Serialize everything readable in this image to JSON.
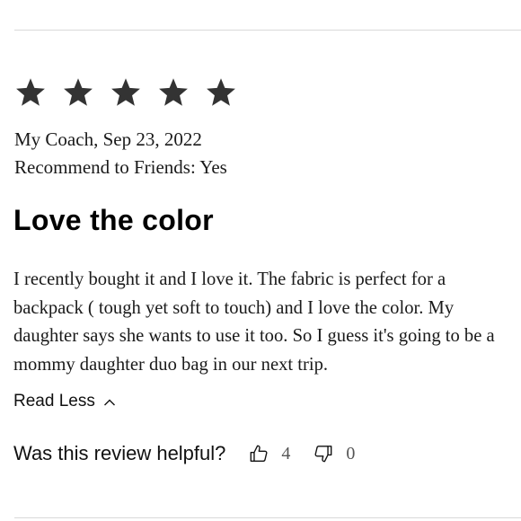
{
  "review": {
    "rating": 5,
    "stars": [
      "star-filled",
      "star-filled",
      "star-filled",
      "star-filled",
      "star-filled"
    ],
    "author_date": "My Coach, Sep 23, 2022",
    "recommend": "Recommend to Friends: Yes",
    "title": "Love the color",
    "body": "I recently bought it and I love it. The fabric is perfect for a backpack ( tough yet soft to touch) and I love the color. My daughter says she wants to use it too. So I guess it's going to be a mommy daughter duo bag in our next trip.",
    "read_less_label": "Read Less",
    "read_less_icon": "chevron-up-icon"
  },
  "helpful": {
    "label": "Was this review helpful?",
    "up_icon": "thumbs-up-icon",
    "up_count": "4",
    "down_icon": "thumbs-down-icon",
    "down_count": "0"
  },
  "colors": {
    "star": "#333333",
    "text": "#1a1a1a",
    "divider": "#d9d9d9"
  }
}
